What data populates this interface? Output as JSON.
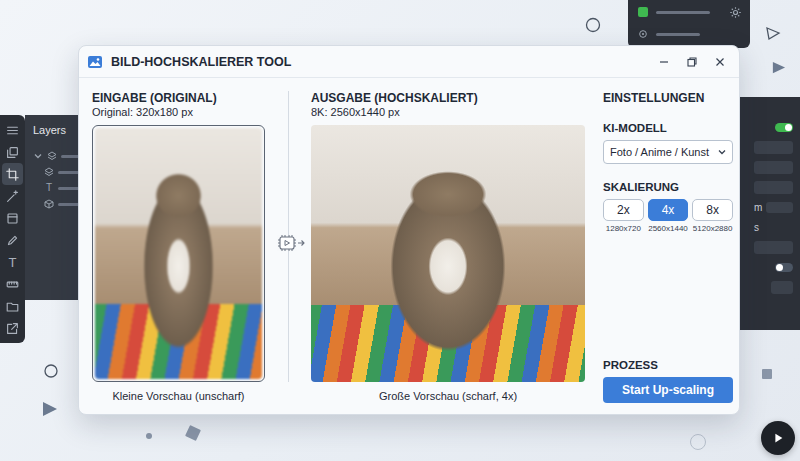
{
  "window": {
    "title": "BILD-HOCHSKALIERER TOOL"
  },
  "input": {
    "heading": "EINGABE (ORIGINAL)",
    "info": "Original: 320x180 px",
    "caption": "Kleine Vorschau (unscharf)"
  },
  "output": {
    "heading": "AUSGABE (HOCHSKALIERT)",
    "info": "8K: 2560x1440 px",
    "caption": "Große Vorschau (scharf, 4x)"
  },
  "settings": {
    "heading": "EINSTELLUNGEN",
    "model": {
      "label": "KI-MODELL",
      "value": "Foto / Anime / Kunst"
    },
    "scale": {
      "label": "SKALIERUNG",
      "options": [
        {
          "label": "2x",
          "resolution": "1280x720",
          "selected": false
        },
        {
          "label": "4x",
          "resolution": "2560x1440",
          "selected": true
        },
        {
          "label": "8x",
          "resolution": "5120x2880",
          "selected": false
        }
      ]
    },
    "process": {
      "label": "PROZESS",
      "button": "Start Up-scaling"
    }
  },
  "toolbar": {
    "tools": [
      {
        "kind": "menu",
        "selected": false
      },
      {
        "kind": "pages",
        "selected": false
      },
      {
        "kind": "crop",
        "selected": true
      },
      {
        "kind": "wand",
        "selected": false
      },
      {
        "kind": "frame",
        "selected": false
      },
      {
        "kind": "brush",
        "selected": false
      },
      {
        "kind": "text",
        "glyph": "T",
        "selected": false
      },
      {
        "kind": "ruler",
        "selected": false
      },
      {
        "kind": "folder",
        "selected": false
      },
      {
        "kind": "export",
        "selected": false
      }
    ]
  },
  "layers_panel": {
    "title": "Layers",
    "items": [
      {
        "kind": "group"
      },
      {
        "kind": "stack"
      },
      {
        "kind": "text",
        "glyph": "T"
      },
      {
        "kind": "shape"
      }
    ]
  },
  "top_panel": {
    "checked": true
  },
  "right_panel": {
    "toggles": [
      {
        "on": true
      },
      {
        "on": false
      }
    ],
    "labels": [
      "m",
      "s"
    ]
  }
}
